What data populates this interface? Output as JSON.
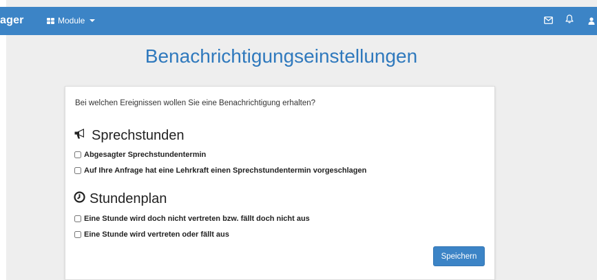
{
  "navbar": {
    "brand": "ager",
    "module_label": "Module",
    "icons": [
      "envelope-icon",
      "bell-icon",
      "user-icon"
    ],
    "color": "#3c84c6"
  },
  "page": {
    "title": "Benachrichtigungseinstellungen",
    "title_color": "#2f79bd"
  },
  "card": {
    "intro": "Bei welchen Ereignissen wollen Sie eine Benachrichtigung erhalten?",
    "sections": [
      {
        "icon": "megaphone-icon",
        "title": "Sprechstunden",
        "options": [
          {
            "label": "Abgesagter Sprechstundentermin",
            "checked": false
          },
          {
            "label": "Auf Ihre Anfrage hat eine Lehrkraft einen Sprechstundentermin vorgeschlagen",
            "checked": false
          }
        ]
      },
      {
        "icon": "clock-icon",
        "title": "Stundenplan",
        "options": [
          {
            "label": "Eine Stunde wird doch nicht vertreten bzw. fällt doch nicht aus",
            "checked": false
          },
          {
            "label": "Eine Stunde wird vertreten oder fällt aus",
            "checked": false
          }
        ]
      }
    ],
    "save_label": "Speichern"
  }
}
